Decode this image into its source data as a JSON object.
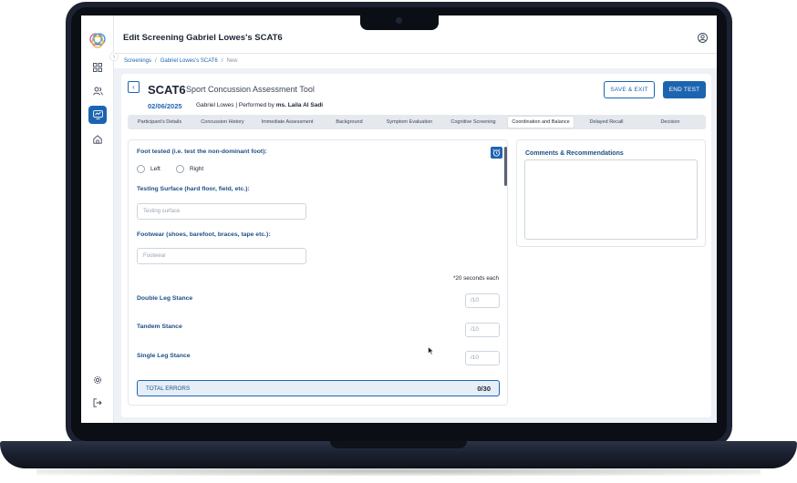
{
  "app": {
    "title": "Edit Screening Gabriel Lowes's SCAT6",
    "icons": [
      "logo-icon",
      "dashboard-icon",
      "users-icon",
      "screening-icon",
      "home-icon",
      "settings-icon",
      "logout-icon",
      "user-circle-icon"
    ],
    "accent": "#1d64b0"
  },
  "breadcrumb": {
    "items": [
      "Screenings",
      "Gabriel Lowes's SCAT6",
      "New"
    ],
    "separator": "/"
  },
  "header": {
    "test_name": "SCAT6",
    "test_full_name": "Sport Concussion Assessment Tool",
    "date": "02/06/2025",
    "patient": "Gabriel Lowes",
    "performed_by_prefix": " | Performed by ",
    "performer": "ms. Laila Al Sadi",
    "save_label": "SAVE & EXIT",
    "end_label": "END TEST"
  },
  "tabs": [
    {
      "label": "Participant's Details"
    },
    {
      "label": "Concussion History"
    },
    {
      "label": "Immediate Assessment"
    },
    {
      "label": "Background"
    },
    {
      "label": "Symptom Evaluation"
    },
    {
      "label": "Cognitive Screening"
    },
    {
      "label": "Coordination and Balance",
      "active": true
    },
    {
      "label": "Delayed Recall"
    },
    {
      "label": "Decision"
    }
  ],
  "form": {
    "foot_label": "Foot tested (i.e. test the non-dominant foot):",
    "foot_options": [
      "Left",
      "Right"
    ],
    "surface_label": "Testing Surface (hard floor, field, etc.):",
    "surface_placeholder": "Testing surface",
    "footwear_label": "Footwear (shoes, barefoot, braces, tape etc.):",
    "footwear_placeholder": "Footwear",
    "note": "*20 seconds each",
    "stances": [
      {
        "label": "Double Leg Stance",
        "placeholder": "/10"
      },
      {
        "label": "Tandem Stance",
        "placeholder": "/10"
      },
      {
        "label": "Single Leg Stance",
        "placeholder": "/10"
      }
    ],
    "total_label": "TOTAL ERRORS",
    "total_value": "0/30"
  },
  "comments": {
    "label": "Comments & Recommendations"
  }
}
